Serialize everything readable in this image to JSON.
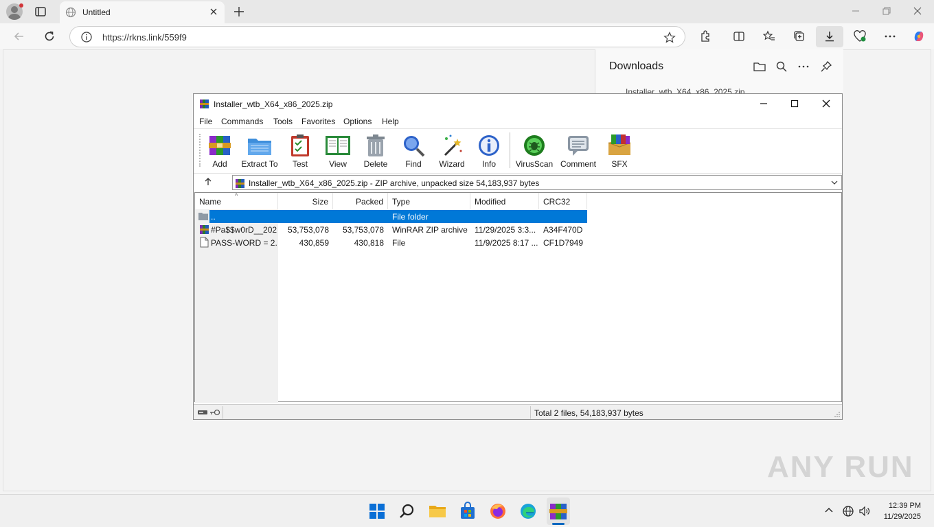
{
  "browser": {
    "tab_title": "Untitled",
    "url": "https://rkns.link/559f9",
    "window_controls": [
      "minimize",
      "restore",
      "close"
    ]
  },
  "downloads_panel": {
    "title": "Downloads",
    "file_name": "Installer_wtb_X64_x86_2025.zip"
  },
  "winrar": {
    "window_title": "Installer_wtb_X64_x86_2025.zip",
    "menu": [
      "File",
      "Commands",
      "Tools",
      "Favorites",
      "Options",
      "Help"
    ],
    "toolbar": [
      "Add",
      "Extract To",
      "Test",
      "View",
      "Delete",
      "Find",
      "Wizard",
      "Info",
      "VirusScan",
      "Comment",
      "SFX"
    ],
    "path": "Installer_wtb_X64_x86_2025.zip - ZIP archive, unpacked size 54,183,937 bytes",
    "columns": [
      "Name",
      "Size",
      "Packed",
      "Type",
      "Modified",
      "CRC32"
    ],
    "rows": [
      {
        "name": "..",
        "size": "",
        "packed": "",
        "type": "File folder",
        "modified": "",
        "crc": "",
        "icon": "folder-icon"
      },
      {
        "name": "#Pa$$w0rD__202...",
        "size": "53,753,078",
        "packed": "53,753,078",
        "type": "WinRAR ZIP archive",
        "modified": "11/29/2025 3:3...",
        "crc": "A34F470D",
        "icon": "winrar-archive-icon"
      },
      {
        "name": "PASS-WORD = 2...",
        "size": "430,859",
        "packed": "430,818",
        "type": "File",
        "modified": "11/9/2025 8:17 ...",
        "crc": "CF1D7949",
        "icon": "file-icon"
      }
    ],
    "status": "Total 2 files, 54,183,937 bytes"
  },
  "watermark": "ANY RUN",
  "taskbar": {
    "time": "12:39 PM",
    "date": "11/29/2025"
  },
  "colors": {
    "selection": "#0078d7",
    "accent": "#0067c0"
  }
}
